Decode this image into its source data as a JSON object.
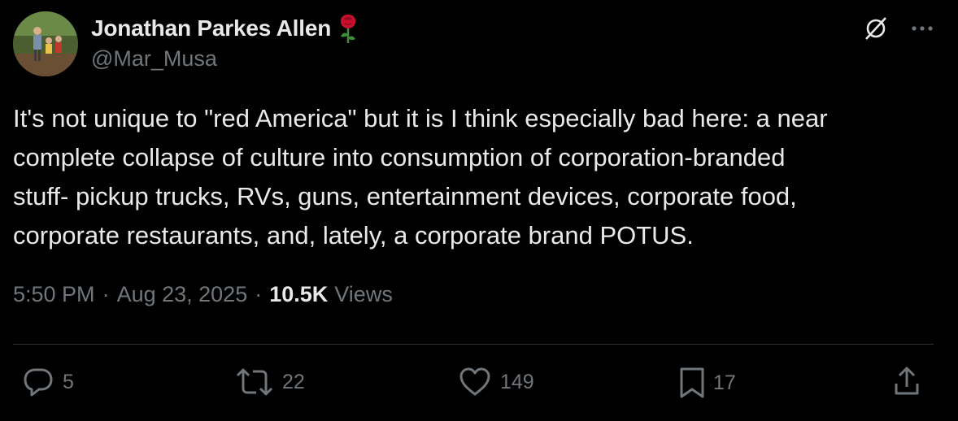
{
  "author": {
    "display_name": "Jonathan Parkes Allen",
    "handle": "@Mar_Musa",
    "name_emoji": "rose-emoji"
  },
  "tweet": {
    "text": "It's not unique to \"red America\" but it is I think especially bad here: a near\ncomplete collapse of culture into consumption of corporation-branded\nstuff- pickup trucks, RVs, guns, entertainment devices, corporate food,\ncorporate restaurants, and, lately, a corporate brand POTUS."
  },
  "meta": {
    "time": "5:50 PM",
    "separator": "·",
    "date": "Aug 23, 2025",
    "views_count": "10.5K",
    "views_label": "Views"
  },
  "actions": {
    "replies": "5",
    "reposts": "22",
    "likes": "149",
    "bookmarks": "17"
  },
  "icons": {
    "top_right": [
      "grok-icon",
      "more-icon"
    ],
    "bottom": [
      "reply-icon",
      "repost-icon",
      "like-icon",
      "bookmark-icon",
      "share-icon"
    ]
  },
  "colors": {
    "background": "#000000",
    "primary_text": "#e7e9ea",
    "secondary_text": "#71767b",
    "divider": "#2f3336",
    "rose": "#c8102e"
  }
}
